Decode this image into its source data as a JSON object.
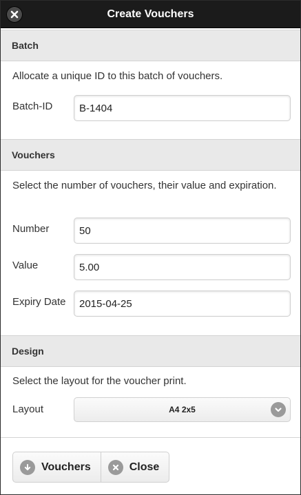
{
  "dialog": {
    "title": "Create Vouchers",
    "close_icon": "close-x-icon"
  },
  "batch": {
    "section_title": "Batch",
    "description": "Allocate a unique ID to this batch of vouchers.",
    "batch_id_label": "Batch-ID",
    "batch_id_value": "B-1404"
  },
  "vouchers": {
    "section_title": "Vouchers",
    "description": "Select the number of vouchers, their value and expiration.",
    "number_label": "Number",
    "number_value": "50",
    "value_label": "Value",
    "value_value": "5.00",
    "expiry_label": "Expiry Date",
    "expiry_value": "2015-04-25"
  },
  "design": {
    "section_title": "Design",
    "description": "Select the layout for the voucher print.",
    "layout_label": "Layout",
    "layout_selected": "A4 2x5",
    "dropdown_icon": "chevron-down-icon"
  },
  "footer": {
    "vouchers_button": "Vouchers",
    "vouchers_icon": "arrow-down-icon",
    "close_button": "Close",
    "close_icon": "close-icon"
  },
  "colors": {
    "header_bg": "#1b1b1b",
    "section_bg": "#e9e9e9",
    "icon_grey": "#9a9a9a"
  }
}
